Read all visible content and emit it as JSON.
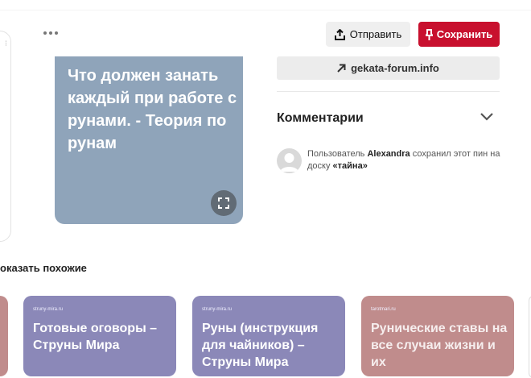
{
  "toolbar": {
    "share_label": "Отправить",
    "save_label": "Сохранить"
  },
  "pin": {
    "image_text": "Что должен занать каждый при работе с рунами. - Теория по рунам"
  },
  "source": {
    "domain": "gekata-forum.info"
  },
  "comments": {
    "title": "Комментарии"
  },
  "activity": {
    "prefix": "Пользователь",
    "user": "Alexandra",
    "middle": "сохранил этот пин на доску",
    "board": "«тайна»"
  },
  "similar": {
    "title": "оказать похожие",
    "cards": [
      {
        "site": "",
        "title": ""
      },
      {
        "site": "struny-mira.ru",
        "title": "Готовые оговоры – Струны Мира"
      },
      {
        "site": "struny-mira.ru",
        "title": "Руны (инструкция для чайников) – Струны Мира"
      },
      {
        "site": "tarotmari.ru",
        "title": "Рунические ставы на все случаи жизни и их"
      }
    ]
  },
  "colors": {
    "save_red": "#c8102e",
    "pin_image_bg": "#8fa4ba",
    "card_purple": "#8b88b8",
    "card_rose": "#c08c8c"
  }
}
